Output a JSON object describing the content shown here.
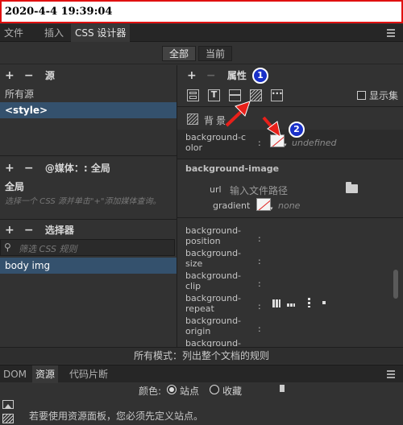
{
  "timestamp": "2020-4-4 19:39:04",
  "tabs": {
    "file": "文件",
    "insert": "插入",
    "css_designer": "CSS 设计器"
  },
  "filter": {
    "all": "全部",
    "current": "当前"
  },
  "sources": {
    "title": "源",
    "items": [
      "所有源",
      "<style>"
    ]
  },
  "media": {
    "title": "@媒体：: 全局",
    "global": "全局",
    "hint": "选择一个 CSS 源并单击\"+\"添加媒体查询。"
  },
  "selectors": {
    "title": "选择器",
    "search_placeholder": "筛选 CSS 规则",
    "items": [
      "body img"
    ]
  },
  "properties": {
    "title": "属性",
    "show_set": "显示集",
    "background_header": "背景",
    "background_color_label": "background-color",
    "background_color_value": "undefined",
    "background_image_header": "background-image",
    "url_label": "url",
    "url_placeholder": "输入文件路径",
    "gradient_label": "gradient",
    "gradient_value": "none",
    "labels": [
      "background-position",
      "background-size",
      "background-clip",
      "background-repeat",
      "background-origin",
      "background-"
    ]
  },
  "status_text": "所有模式：列出整个文档的规则",
  "bottom_tabs": {
    "dom": "DOM",
    "assets": "资源",
    "snippets": "代码片断"
  },
  "assets": {
    "color_label": "颜色:",
    "site": "站点",
    "favorites": "收藏",
    "message": "若要使用资源面板，您必须先定义站点。"
  },
  "annotations": {
    "badge1": "1",
    "badge2": "2"
  },
  "colors": {
    "selected": "#34516d",
    "arrow": "#e8201a",
    "badge": "#1930c8"
  }
}
